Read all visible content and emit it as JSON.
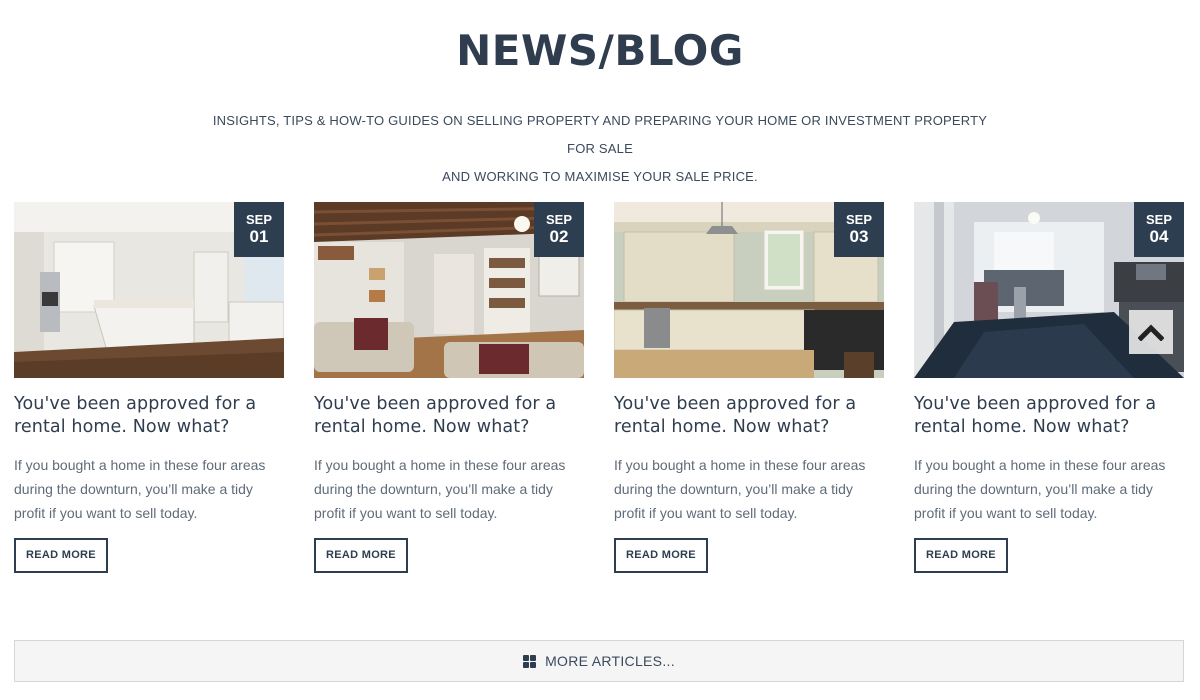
{
  "header": {
    "title": "NEWS/BLOG",
    "intro_line1": "INSIGHTS, TIPS & HOW-TO GUIDES ON SELLING PROPERTY AND PREPARING YOUR HOME OR INVESTMENT PROPERTY FOR SALE",
    "intro_line2": "AND WORKING TO MAXIMISE YOUR SALE PRICE."
  },
  "posts": [
    {
      "month": "SEP",
      "day": "01",
      "title": "You've been approved for a rental home. Now what?",
      "excerpt": "If you bought a home in these four areas during the downturn, you’ll make a tidy profit if you want to sell today.",
      "cta": "READ MORE",
      "image": "kitchen-wood-floor-photo"
    },
    {
      "month": "SEP",
      "day": "02",
      "title": "You've been approved for a rental home. Now what?",
      "excerpt": "If you bought a home in these four areas during the downturn, you’ll make a tidy profit if you want to sell today.",
      "cta": "READ MORE",
      "image": "living-room-beams-photo"
    },
    {
      "month": "SEP",
      "day": "03",
      "title": "You've been approved for a rental home. Now what?",
      "excerpt": "If you bought a home in these four areas during the downturn, you’ll make a tidy profit if you want to sell today.",
      "cta": "READ MORE",
      "image": "cream-kitchen-photo"
    },
    {
      "month": "SEP",
      "day": "04",
      "title": "You've been approved for a rental home. Now what?",
      "excerpt": "If you bought a home in these four areas during the downturn, you’ll make a tidy profit if you want to sell today.",
      "cta": "READ MORE",
      "image": "dark-floor-kitchen-photo"
    }
  ],
  "scroll_top": {
    "icon": "chevron-up-icon"
  },
  "more_articles": {
    "label": "MORE ARTICLES...",
    "icon": "grid-icon"
  },
  "colors": {
    "navy": "#2e3e51",
    "text": "#5f6b78",
    "panel": "#f5f5f5"
  }
}
